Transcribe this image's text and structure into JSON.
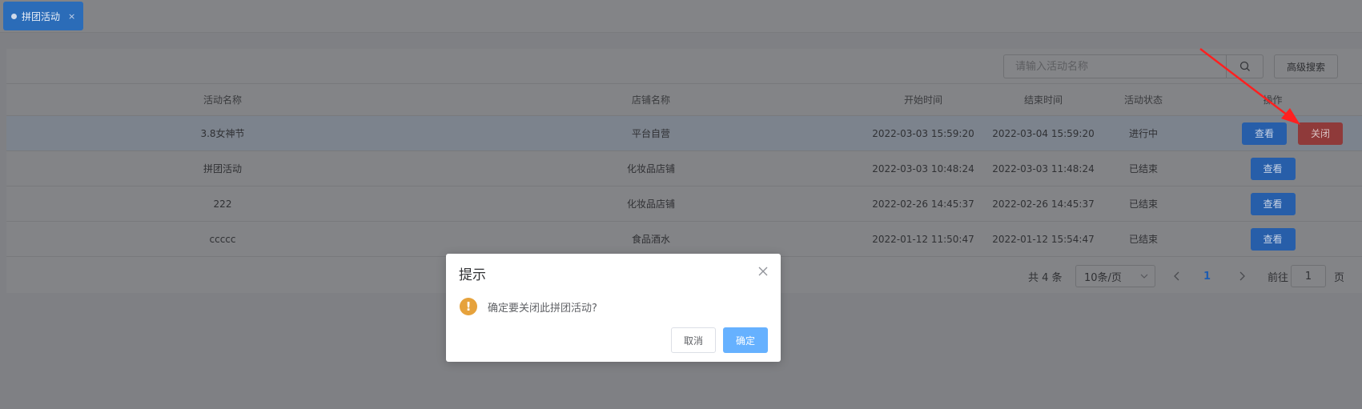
{
  "tabs": [
    {
      "label": "拼团活动",
      "close": "×"
    }
  ],
  "toolbar": {
    "search_placeholder": "请输入活动名称",
    "search_icon": "search-icon",
    "advanced_label": "高级搜索"
  },
  "table": {
    "headers": [
      "活动名称",
      "店铺名称",
      "开始时间",
      "结束时间",
      "活动状态",
      "操作"
    ],
    "rows": [
      {
        "name": "3.8女神节",
        "shop": "平台自营",
        "start": "2022-03-03 15:59:20",
        "end": "2022-03-04 15:59:20",
        "status": "进行中",
        "view": "查看",
        "close": "关闭"
      },
      {
        "name": "拼团活动",
        "shop": "化妆品店铺",
        "start": "2022-03-03 10:48:24",
        "end": "2022-03-03 11:48:24",
        "status": "已结束",
        "view": "查看"
      },
      {
        "name": "222",
        "shop": "化妆品店铺",
        "start": "2022-02-26 14:45:37",
        "end": "2022-02-26 14:45:37",
        "status": "已结束",
        "view": "查看"
      },
      {
        "name": "ccccc",
        "shop": "食品酒水",
        "start": "2022-01-12 11:50:47",
        "end": "2022-01-12 15:54:47",
        "status": "已结束",
        "view": "查看"
      }
    ]
  },
  "pagination": {
    "total": "共 4 条",
    "page_size": "10条/页",
    "current_page": "1",
    "goto_label": "前往",
    "goto_value": "1",
    "page_suffix": "页"
  },
  "dialog": {
    "title": "提示",
    "message": "确定要关闭此拼团活动?",
    "cancel": "取消",
    "confirm": "确定",
    "icon": "warning-icon"
  },
  "colors": {
    "primary": "#409eff",
    "danger": "#f56c6c",
    "warning": "#e6a23c",
    "annotation_arrow": "#ff2020"
  }
}
